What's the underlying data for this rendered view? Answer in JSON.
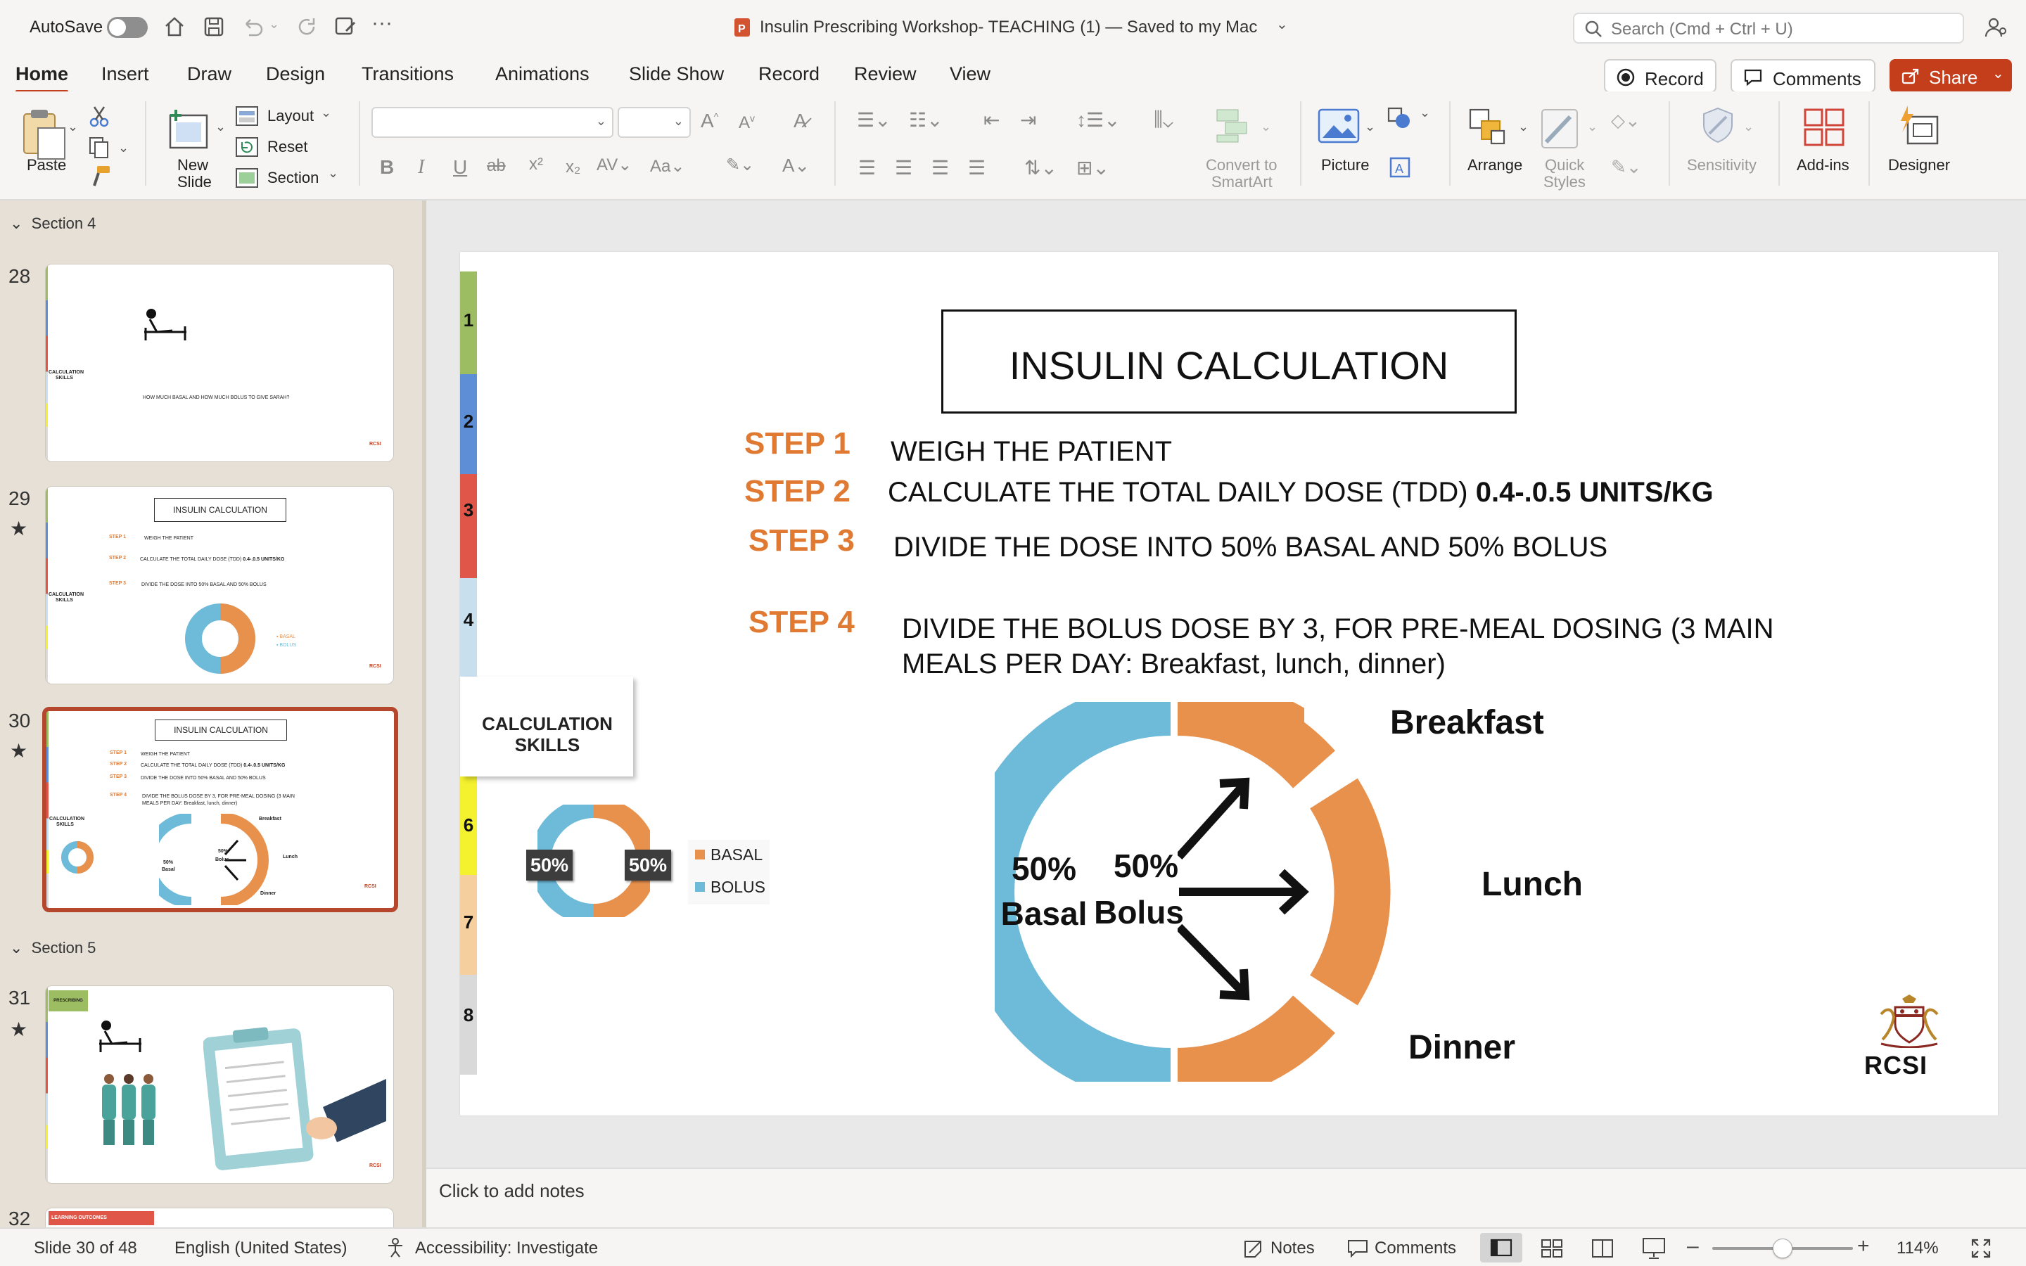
{
  "titlebar": {
    "autosave": "AutoSave",
    "doc_title": "Insulin Prescribing Workshop- TEACHING (1) — Saved to my Mac",
    "search_placeholder": "Search (Cmd + Ctrl + U)"
  },
  "tabs": [
    "Home",
    "Insert",
    "Draw",
    "Design",
    "Transitions",
    "Animations",
    "Slide Show",
    "Record",
    "Review",
    "View"
  ],
  "right_buttons": {
    "record": "Record",
    "comments": "Comments",
    "share": "Share"
  },
  "ribbon": {
    "paste": "Paste",
    "new_slide_1": "New",
    "new_slide_2": "Slide",
    "layout": "Layout",
    "reset": "Reset",
    "section": "Section",
    "convert_1": "Convert to",
    "convert_2": "SmartArt",
    "picture": "Picture",
    "arrange": "Arrange",
    "quick_1": "Quick",
    "quick_2": "Styles",
    "sensitivity": "Sensitivity",
    "addins": "Add-ins",
    "designer": "Designer"
  },
  "panel": {
    "section4": "Section 4",
    "section5": "Section 5",
    "slide_numbers": [
      "28",
      "29",
      "30",
      "31",
      "32"
    ],
    "t28_text": "HOW MUCH BASAL AND HOW MUCH BOLUS TO GIVE SARAH?",
    "t31_tag": "PRESCRIBING",
    "t32_tag": "LEARNING OUTCOMES"
  },
  "slide": {
    "title": "INSULIN CALCULATION",
    "steps": [
      {
        "label": "STEP 1",
        "text": "WEIGH THE PATIENT",
        "bold": ""
      },
      {
        "label": "STEP 2",
        "text": "CALCULATE THE TOTAL DAILY DOSE (TDD) ",
        "bold": "0.4-.0.5 UNITS/KG"
      },
      {
        "label": "STEP 3",
        "text": "DIVIDE THE DOSE INTO 50% BASAL AND 50% BOLUS",
        "bold": ""
      },
      {
        "label": "STEP 4",
        "text": "DIVIDE THE BOLUS DOSE BY 3, FOR PRE-MEAL DOSING (3 MAIN",
        "text2": "MEALS PER DAY: Breakfast, lunch, dinner)",
        "bold": ""
      }
    ],
    "side_tabs": [
      "1",
      "2",
      "3",
      "4",
      "6",
      "7",
      "8"
    ],
    "side_tab_colors": [
      "#9dbd63",
      "#5e8fd6",
      "#e0574a",
      "#c8dfee",
      "#f4f12e",
      "#f6cf9f",
      "#d9d9d9"
    ],
    "calc_skills_1": "CALCULATION",
    "calc_skills_2": "SKILLS",
    "donut": {
      "basal_pct": "50%",
      "bolus_pct": "50%",
      "legend": [
        "BASAL",
        "BOLUS"
      ]
    },
    "diagram": {
      "basal_pct": "50%",
      "basal": "Basal",
      "bolus_pct": "50%",
      "bolus": "Bolus",
      "breakfast": "Breakfast",
      "lunch": "Lunch",
      "dinner": "Dinner"
    },
    "logo": "RCSI"
  },
  "colors": {
    "orange": "#e8914d",
    "blue": "#6dbad9",
    "accent": "#c43e1c"
  },
  "notes_placeholder": "Click to add notes",
  "status": {
    "slide": "Slide 30 of 48",
    "language": "English (United States)",
    "accessibility": "Accessibility: Investigate",
    "notes": "Notes",
    "comments": "Comments",
    "zoom": "114%"
  }
}
